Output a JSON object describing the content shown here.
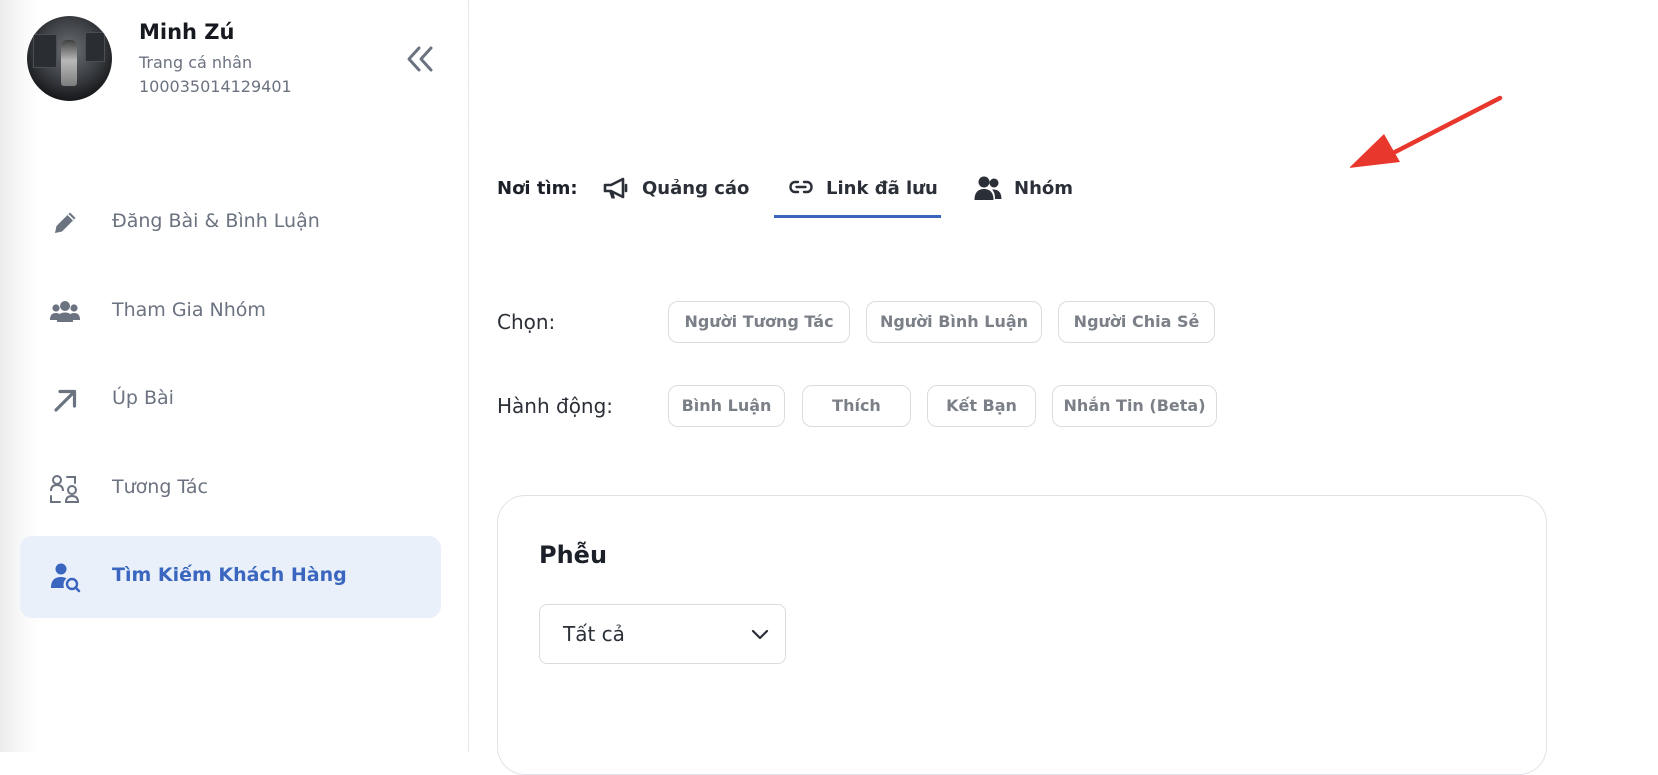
{
  "profile": {
    "name": "Minh Zú",
    "subtitle": "Trang cá nhân",
    "user_id": "100035014129401"
  },
  "sidebar": {
    "collapse_icon": "chevrons-left-icon",
    "items": [
      {
        "label": "Đăng Bài & Bình Luận",
        "icon": "pencil-icon",
        "active": false
      },
      {
        "label": "Tham Gia Nhóm",
        "icon": "users-group-icon",
        "active": false
      },
      {
        "label": "Úp Bài",
        "icon": "arrow-up-right-icon",
        "active": false
      },
      {
        "label": "Tương Tác",
        "icon": "users-interaction-icon",
        "active": false
      },
      {
        "label": "Tìm Kiếm Khách Hàng",
        "icon": "user-search-icon",
        "active": true
      }
    ]
  },
  "search_source": {
    "label": "Nơi tìm:",
    "tabs": [
      {
        "label": "Quảng cáo",
        "icon": "megaphone-icon",
        "active": false
      },
      {
        "label": "Link đã lưu",
        "icon": "link-icon",
        "active": true
      },
      {
        "label": "Nhóm",
        "icon": "users-icon",
        "active": false
      }
    ]
  },
  "select_row": {
    "label": "Chọn:",
    "options": [
      "Người Tương Tác",
      "Người Bình Luận",
      "Người Chia Sẻ"
    ]
  },
  "action_row": {
    "label": "Hành động:",
    "options": [
      "Bình Luận",
      "Thích",
      "Kết Bạn",
      "Nhắn Tin (Beta)"
    ]
  },
  "funnel": {
    "title": "Phễu",
    "selected": "Tất cả"
  },
  "colors": {
    "accent": "#3a66bf",
    "annotation_arrow": "#e8382d"
  }
}
